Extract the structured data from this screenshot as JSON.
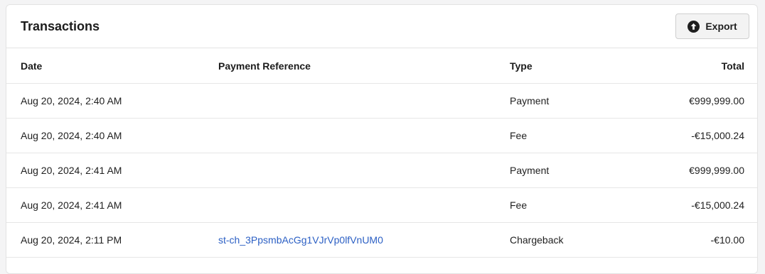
{
  "header": {
    "title": "Transactions",
    "export_label": "Export",
    "export_icon": "upload-arrow-circle-icon"
  },
  "table": {
    "columns": [
      "Date",
      "Payment Reference",
      "Type",
      "Total"
    ],
    "rows": [
      {
        "date": "Aug 20, 2024, 2:40 AM",
        "reference": "",
        "type": "Payment",
        "total": "€999,999.00"
      },
      {
        "date": "Aug 20, 2024, 2:40 AM",
        "reference": "",
        "type": "Fee",
        "total": "-€15,000.24"
      },
      {
        "date": "Aug 20, 2024, 2:41 AM",
        "reference": "",
        "type": "Payment",
        "total": "€999,999.00"
      },
      {
        "date": "Aug 20, 2024, 2:41 AM",
        "reference": "",
        "type": "Fee",
        "total": "-€15,000.24"
      },
      {
        "date": "Aug 20, 2024, 2:11 PM",
        "reference": "st-ch_3PpsmbAcGg1VJrVp0lfVnUM0",
        "type": "Chargeback",
        "total": "-€10.00"
      }
    ]
  },
  "colors": {
    "link": "#2b5fc4",
    "border": "#e3e3e3"
  }
}
